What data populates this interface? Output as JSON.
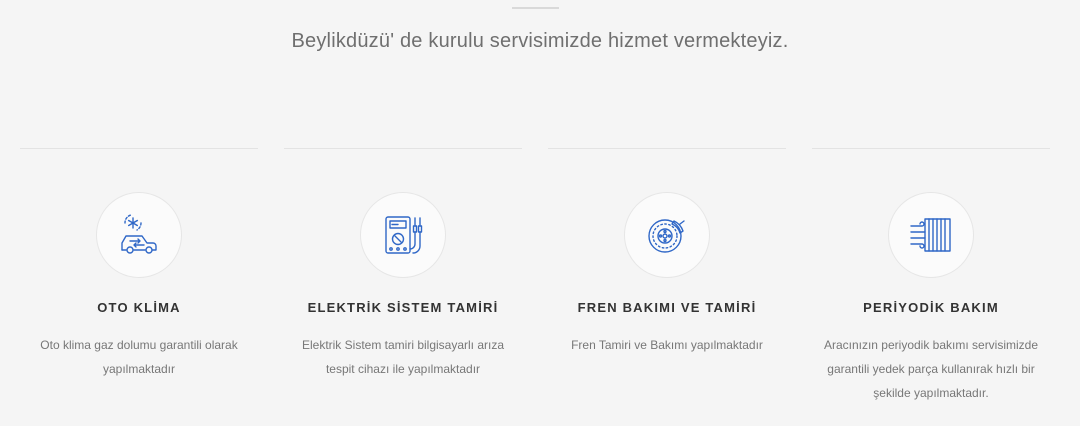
{
  "header": {
    "subtitle": "Beylikdüzü' de kurulu servisimizde hizmet vermekteyiz."
  },
  "colors": {
    "icon_blue": "#2f67c7",
    "title": "#333333",
    "text": "#777777",
    "background": "#f5f5f5"
  },
  "services": [
    {
      "icon": "car-ac-icon",
      "title": "OTO KLİMA",
      "description": "Oto klima gaz dolumu garantili olarak yapılmaktadır"
    },
    {
      "icon": "multimeter-icon",
      "title": "ELEKTRİK SİSTEM TAMİRİ",
      "description": "Elektrik Sistem tamiri bilgisayarlı arıza tespit cihazı ile yapılmaktadır"
    },
    {
      "icon": "brake-disc-icon",
      "title": "FREN BAKIMI VE TAMİRİ",
      "description": "Fren Tamiri ve Bakımı yapılmaktadır"
    },
    {
      "icon": "air-filter-icon",
      "title": "PERİYODİK BAKIM",
      "description": "Aracınızın periyodik bakımı servisimizde garantili yedek parça kullanırak hızlı bir şekilde yapılmaktadır."
    }
  ]
}
